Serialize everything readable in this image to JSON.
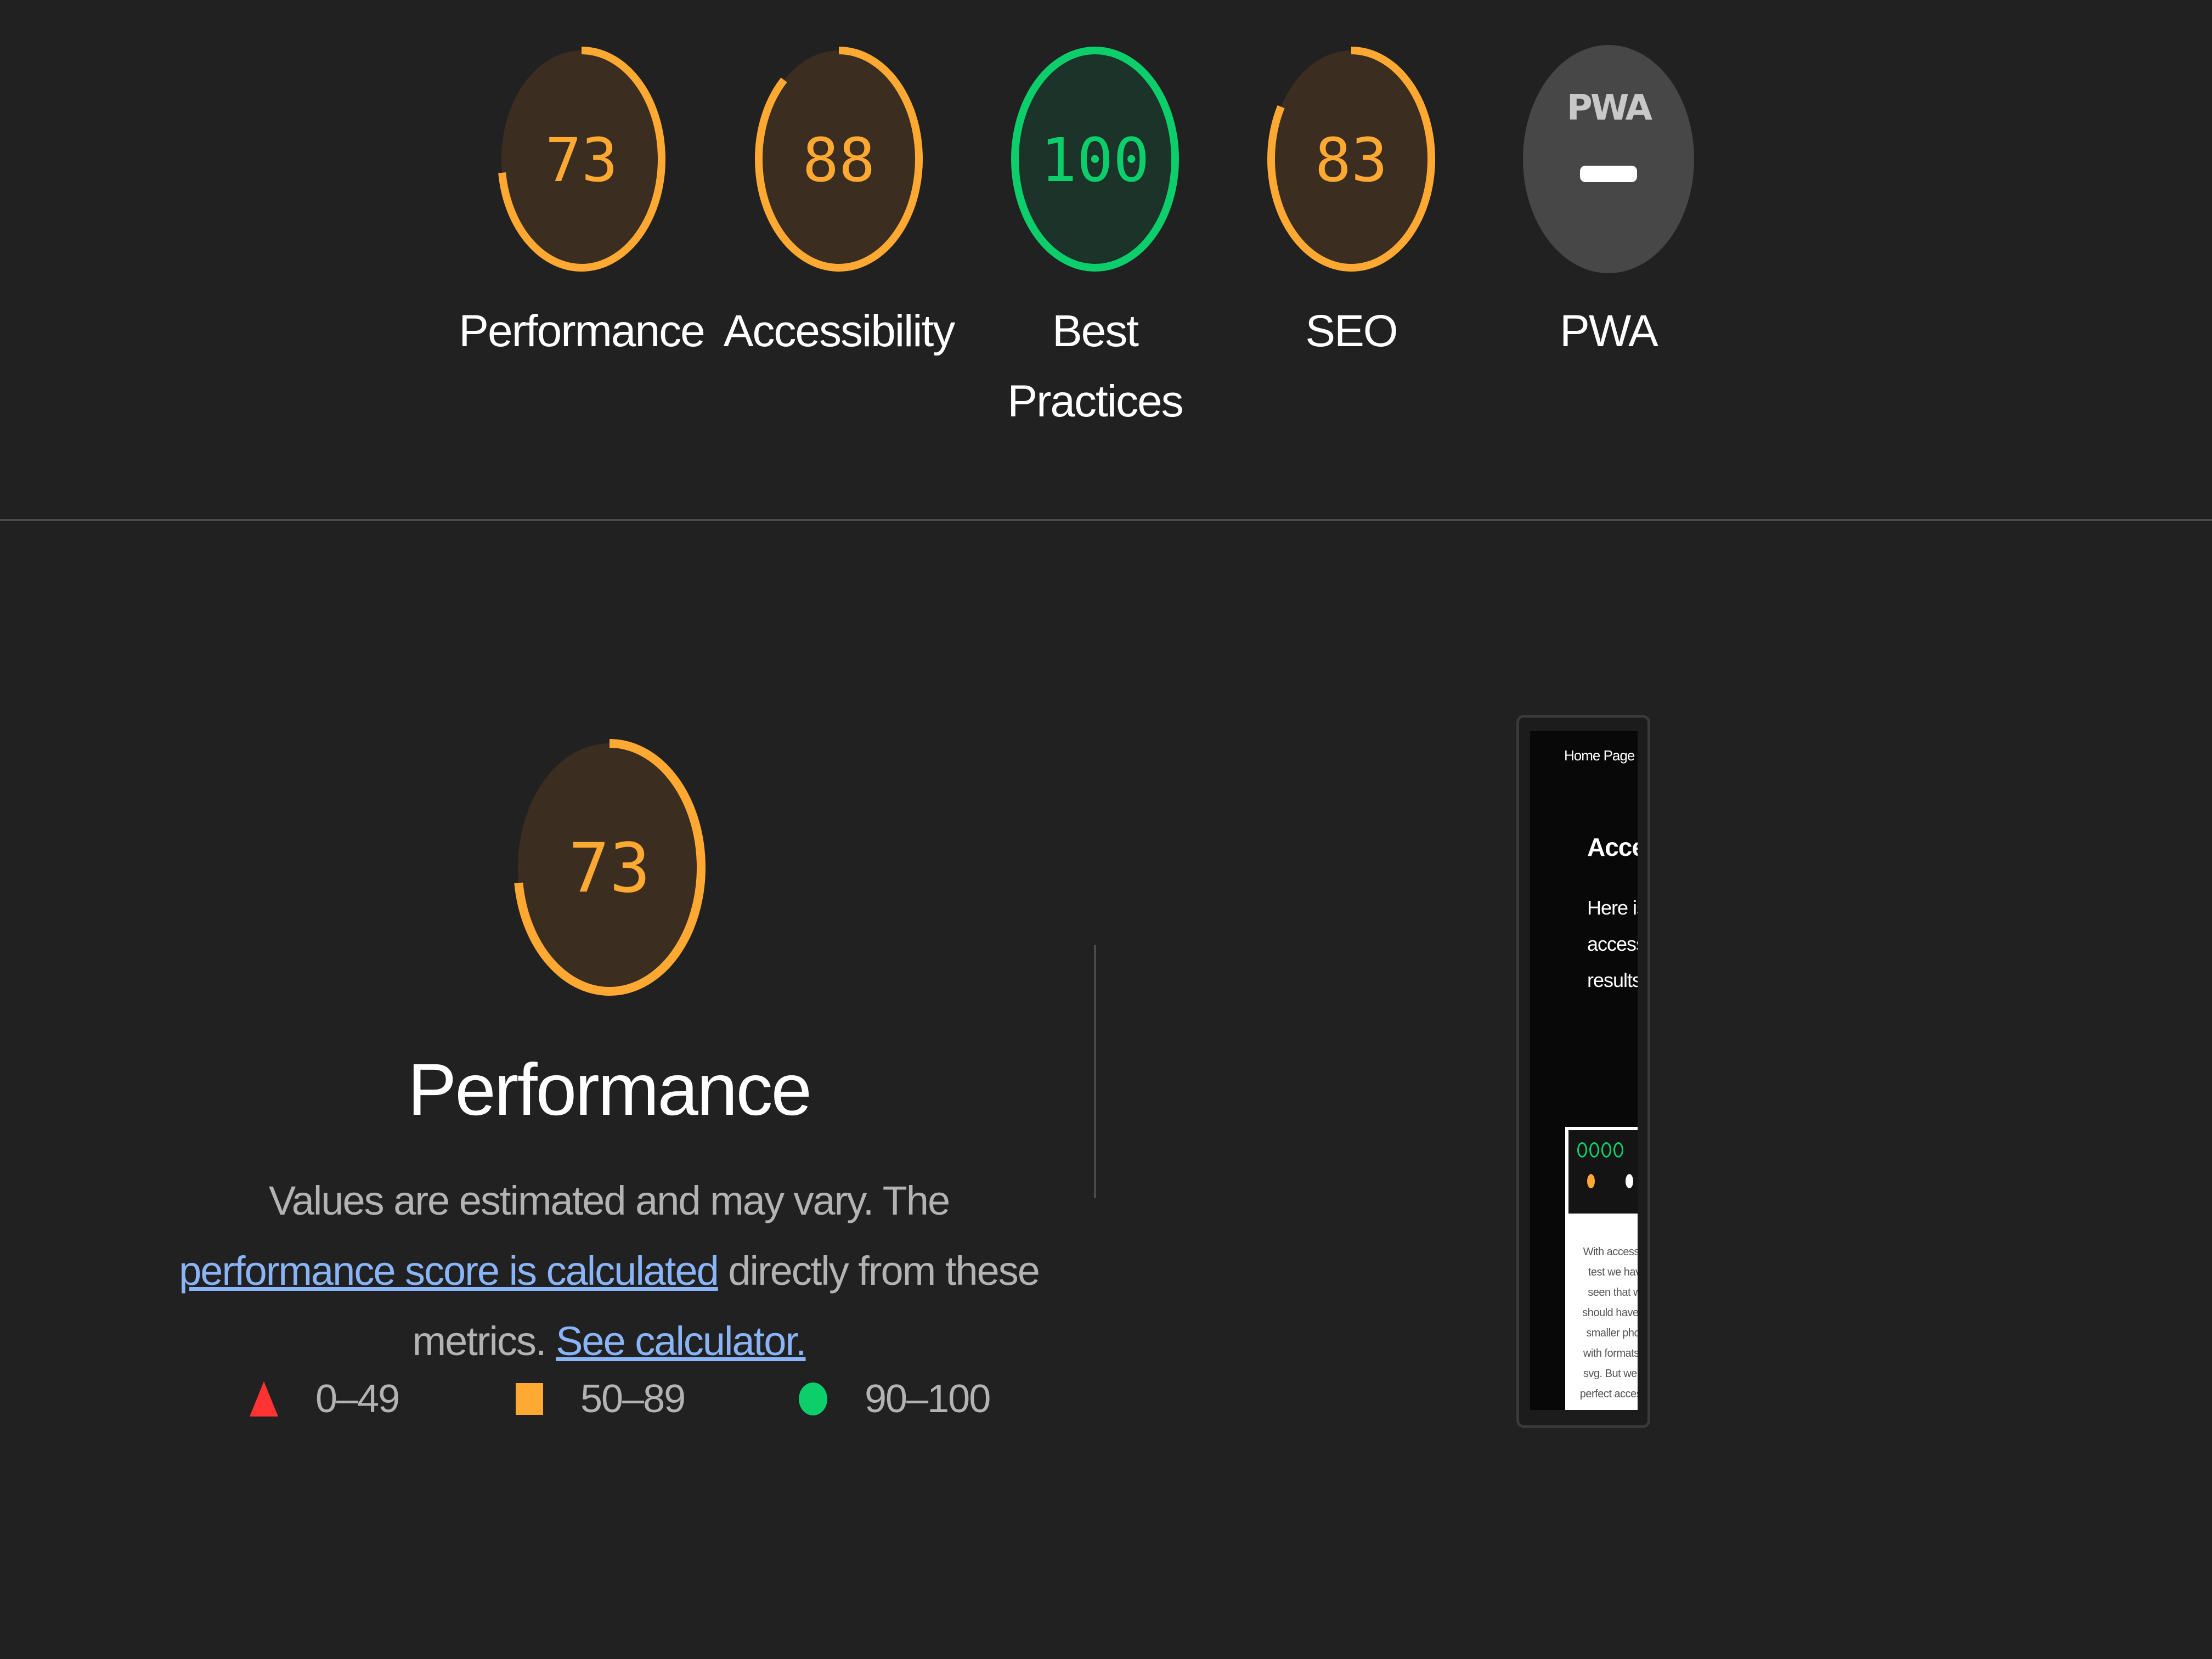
{
  "colors": {
    "background": "#212121",
    "average": "#ffa933",
    "average_fill": "#3b2e21",
    "pass": "#0cce6b",
    "pass_fill": "#1b3328",
    "fail": "#ff3333",
    "pwa_fill": "#474747",
    "link": "#8ab4f8"
  },
  "gauges": [
    {
      "label": "Performance",
      "score": "73",
      "value": 73,
      "rating": "average"
    },
    {
      "label": "Accessibility",
      "score": "88",
      "value": 88,
      "rating": "average"
    },
    {
      "label": "Best Practices",
      "score": "100",
      "value": 100,
      "rating": "pass"
    },
    {
      "label": "SEO",
      "score": "83",
      "value": 83,
      "rating": "average"
    },
    {
      "label": "PWA",
      "badge_text": "PWA",
      "rating": "na"
    }
  ],
  "performance": {
    "score": "73",
    "value": 73,
    "title": "Performance",
    "description_before": "Values are estimated and may vary. The ",
    "link_score": "performance score is calculated",
    "description_middle": " directly from these metrics. ",
    "link_calculator": "See calculator."
  },
  "legend": [
    {
      "range": "0–49",
      "shape": "triangle",
      "color": "#ff3333"
    },
    {
      "range": "50–89",
      "shape": "square",
      "color": "#ffa933"
    },
    {
      "range": "90–100",
      "shape": "circle",
      "color": "#0cce6b"
    }
  ],
  "screenshot": {
    "nav_text": "Home Page   Cont",
    "heading": "Acce",
    "text_lines": [
      "Here is",
      "access",
      "results"
    ],
    "card_text": "With accessibil\ntest we have\nseen that we\nshould have us\nsmaller photo\nwith formats lik\nsvg. But we go\nperfect accessib"
  }
}
